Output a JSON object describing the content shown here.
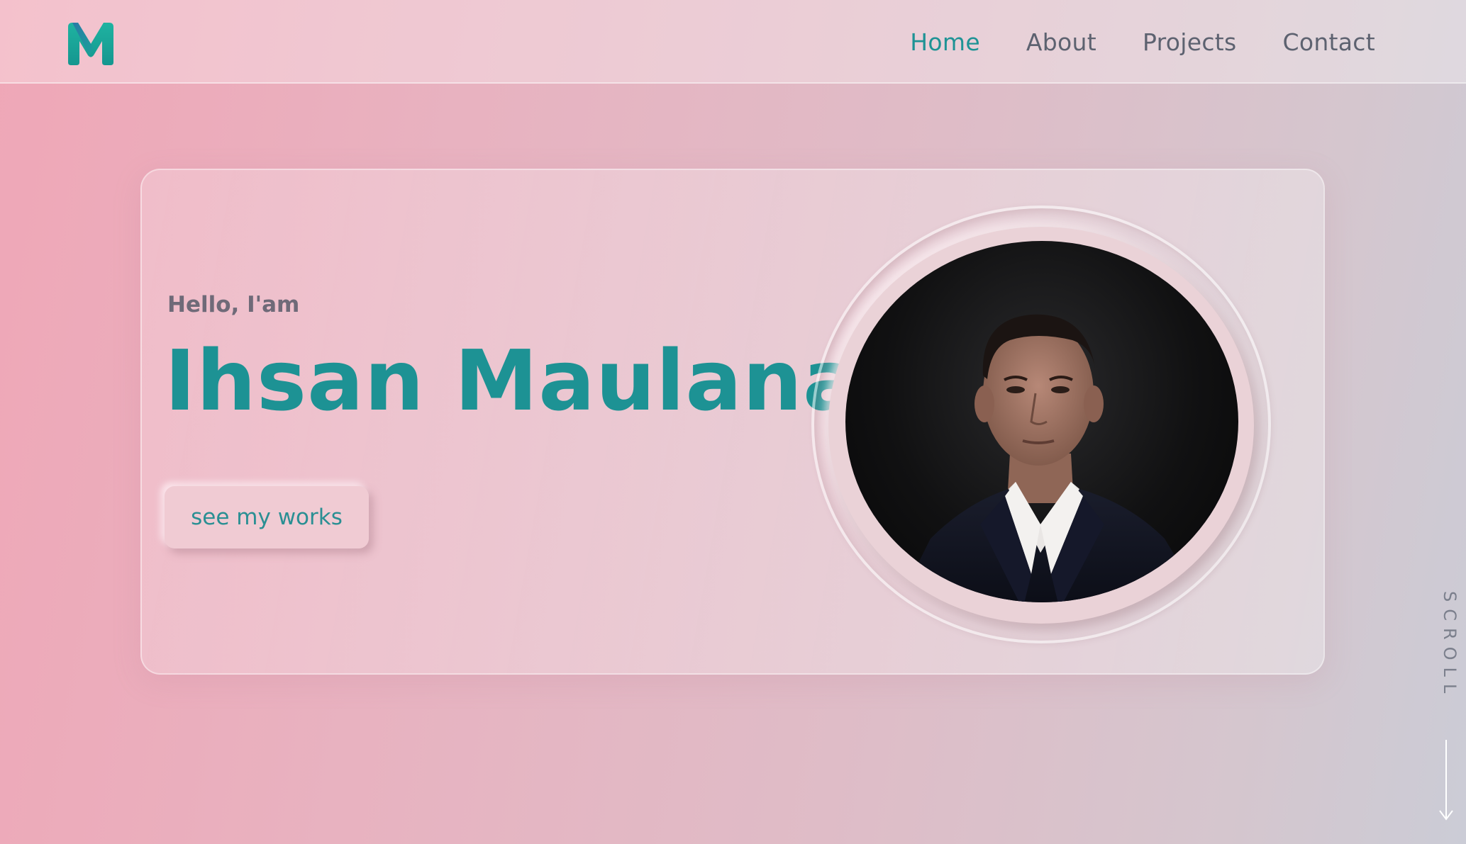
{
  "header": {
    "logo_alt": "M",
    "nav": [
      {
        "label": "Home",
        "active": true
      },
      {
        "label": "About",
        "active": false
      },
      {
        "label": "Projects",
        "active": false
      },
      {
        "label": "Contact",
        "active": false
      }
    ]
  },
  "hero": {
    "greeting": "Hello, I'am",
    "name": "Ihsan Maulana",
    "cta_label": "see my works"
  },
  "scroll": {
    "label": "SCROLL"
  },
  "colors": {
    "accent": "#1d9294",
    "nav_text": "#5d6270",
    "background_left": "#efa7b7",
    "background_right": "#cbccd6"
  }
}
